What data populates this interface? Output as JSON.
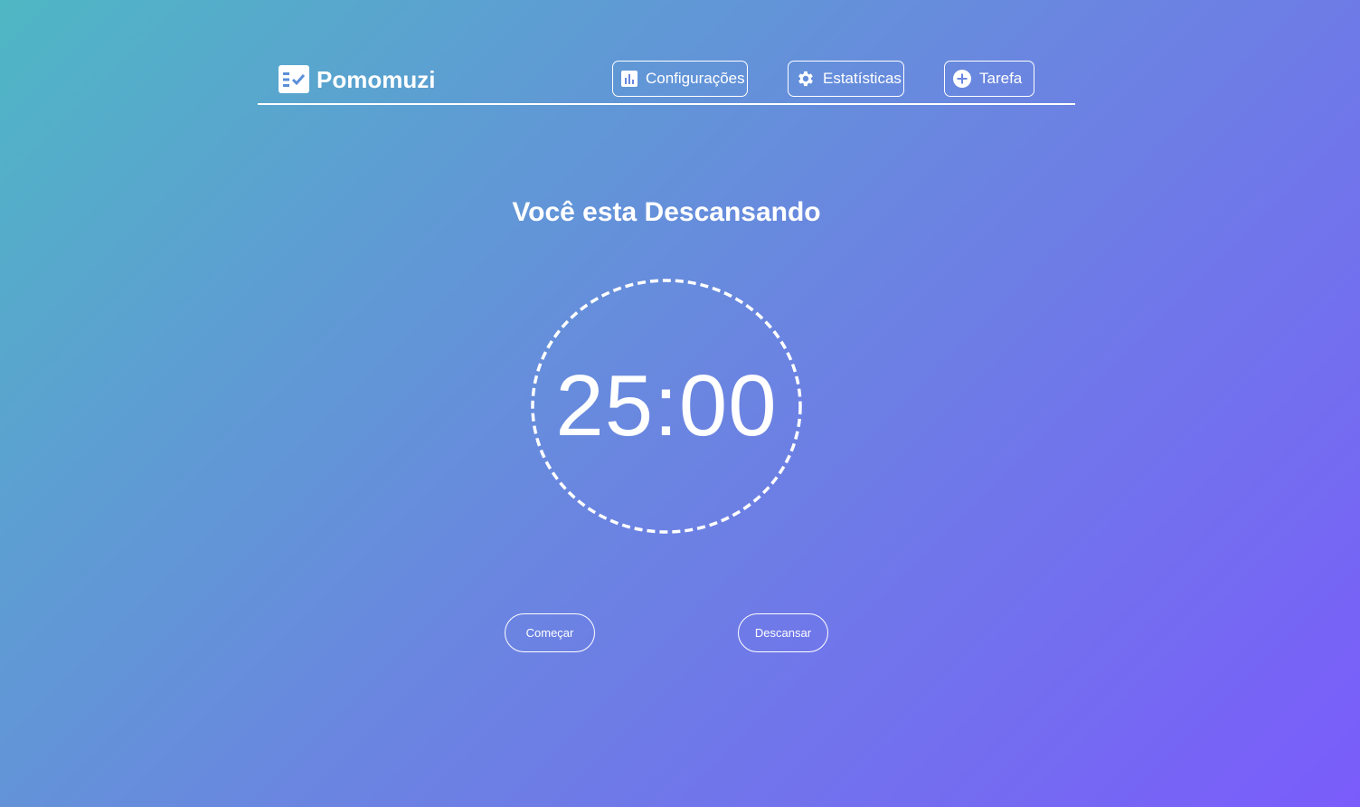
{
  "app": {
    "name": "Pomomuzi",
    "logo_icon": "task-checklist-icon"
  },
  "nav": {
    "settings": {
      "label": "Configurações",
      "icon": "bar-chart-icon"
    },
    "stats": {
      "label": "Estatísticas",
      "icon": "gear-icon"
    },
    "task": {
      "label": "Tarefa",
      "icon": "plus-circle-icon"
    }
  },
  "main": {
    "status": "Você esta Descansando",
    "timer": "25:00",
    "start_label": "Começar",
    "rest_label": "Descansar"
  },
  "colors": {
    "gradient_start": "#4fb7c4",
    "gradient_end": "#7a5cfb",
    "foreground": "#ffffff"
  }
}
